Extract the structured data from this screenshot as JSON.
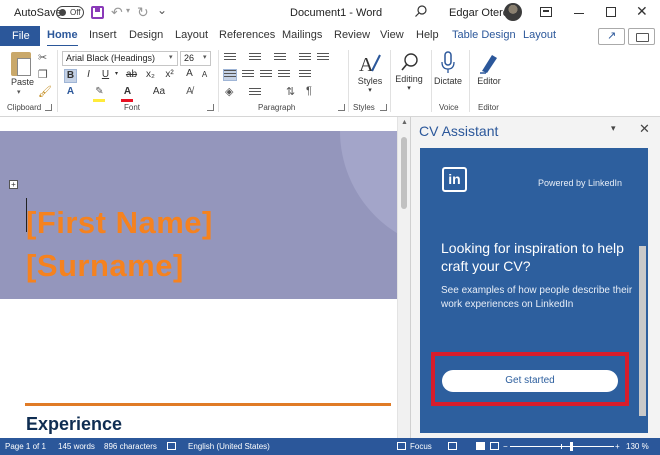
{
  "titlebar": {
    "autosave_label": "AutoSave",
    "autosave_state": "Off",
    "document_title": "Document1  -  Word",
    "user_name": "Edgar Otero"
  },
  "tabs": {
    "file": "File",
    "items": [
      "Home",
      "Insert",
      "Design",
      "Layout",
      "References",
      "Mailings",
      "Review",
      "View",
      "Help",
      "Table Design",
      "Layout"
    ]
  },
  "ribbon": {
    "clipboard": {
      "label": "Clipboard",
      "paste": "Paste"
    },
    "font": {
      "label": "Font",
      "font_name": "Arial Black (Headings)",
      "font_size": "26",
      "bold": "B",
      "italic": "I",
      "underline": "U",
      "strike": "ab",
      "subscript": "x₂",
      "superscript": "x²",
      "clear": "A",
      "grow": "A",
      "shrink": "A",
      "case": "Aa"
    },
    "paragraph": {
      "label": "Paragraph"
    },
    "styles": {
      "label": "Styles",
      "button": "Styles"
    },
    "editing": {
      "button": "Editing"
    },
    "voice": {
      "label": "Voice",
      "button": "Dictate"
    },
    "editor": {
      "label": "Editor",
      "button": "Editor"
    }
  },
  "document": {
    "first_name": "[First Name]",
    "surname": "[Surname]",
    "section_heading": "Experience"
  },
  "pane": {
    "title": "CV Assistant",
    "powered_by": "Powered by LinkedIn",
    "logo_text": "in",
    "heading": "Looking for inspiration to help craft your CV?",
    "body": "See examples of how people describe their work experiences on LinkedIn",
    "cta": "Get started"
  },
  "status": {
    "page": "Page 1 of 1",
    "words": "145 words",
    "characters": "896 characters",
    "language": "English (United States)",
    "focus": "Focus",
    "zoom_out": "−",
    "zoom_in": "+",
    "zoom": "130 %"
  },
  "colors": {
    "accent": "#2b579a",
    "name_orange": "#f5821f",
    "header_fill": "#9496bc",
    "linkedin_card": "#2d5f9e",
    "highlight_red": "#d71d2c"
  }
}
